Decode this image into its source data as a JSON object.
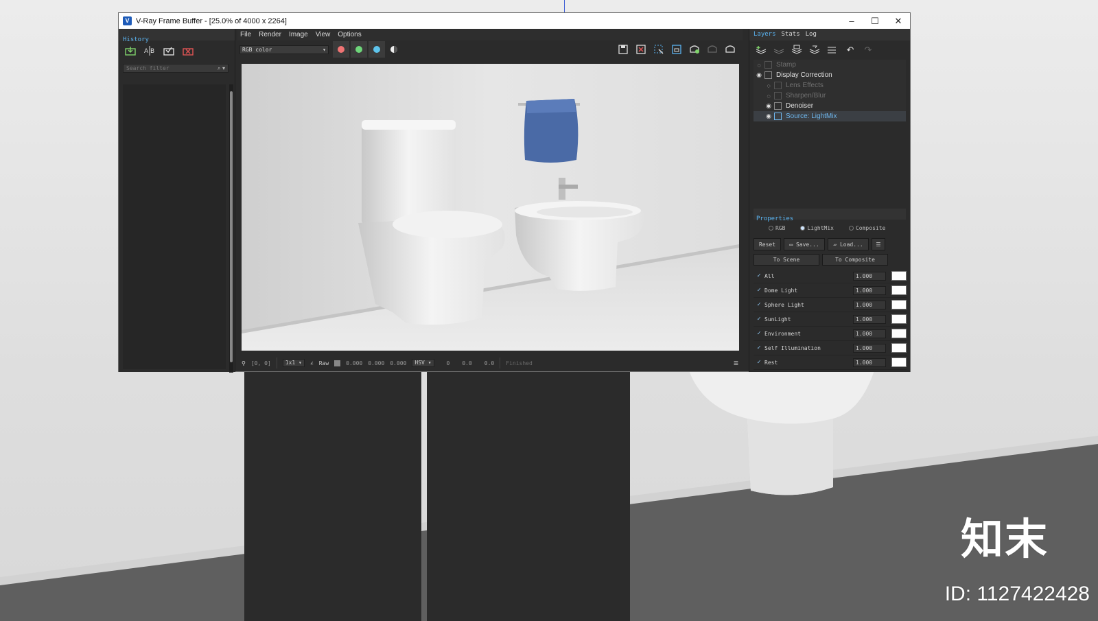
{
  "window": {
    "title": "V-Ray Frame Buffer - [25.0% of 4000 x 2264]",
    "icon": "vray-icon",
    "controls": [
      "–",
      "☐",
      "✕"
    ]
  },
  "history": {
    "tab": "History",
    "search_placeholder": "Search filter",
    "icons": [
      "save-to-history-icon",
      "ab-compare-icon",
      "load-history-icon",
      "remove-history-icon"
    ]
  },
  "menu": [
    "File",
    "Render",
    "Image",
    "View",
    "Options"
  ],
  "toolbar": {
    "channel": "RGB color",
    "colors": {
      "red": "#f07474",
      "green": "#6ed67a",
      "blue": "#5ec4ec"
    }
  },
  "status": {
    "coords": "[0, 0]",
    "zoom": "1x1",
    "raw_label": "Raw",
    "rgb_values": [
      "0.000",
      "0.000",
      "0.000"
    ],
    "color_space": "HSV",
    "hsv_values": [
      "0",
      "0.0",
      "0.0"
    ],
    "state": "Finished"
  },
  "right_panel": {
    "tabs": [
      "Layers",
      "Stats",
      "Log"
    ],
    "layers": [
      {
        "name": "Stamp",
        "visible": false,
        "sub": false
      },
      {
        "name": "Display Correction",
        "visible": true,
        "sub": false
      },
      {
        "name": "Lens Effects",
        "visible": false,
        "sub": true
      },
      {
        "name": "Sharpen/Blur",
        "visible": false,
        "sub": true
      },
      {
        "name": "Denoiser",
        "visible": true,
        "sub": true
      },
      {
        "name": "Source: LightMix",
        "visible": true,
        "sub": true
      }
    ],
    "properties_label": "Properties",
    "modes": [
      "RGB",
      "LightMix",
      "Composite"
    ],
    "selected_mode": "LightMix",
    "buttons": {
      "reset": "Reset",
      "save": "Save...",
      "load": "Load...",
      "to_scene": "To Scene",
      "to_composite": "To Composite"
    },
    "lightmix": [
      {
        "name": "All",
        "value": "1.000"
      },
      {
        "name": "Dome Light",
        "value": "1.000"
      },
      {
        "name": "Sphere Light",
        "value": "1.000"
      },
      {
        "name": "SunLight",
        "value": "1.000"
      },
      {
        "name": "Environment",
        "value": "1.000"
      },
      {
        "name": "Self Illumination",
        "value": "1.000"
      },
      {
        "name": "Rest",
        "value": "1.000"
      }
    ]
  },
  "watermark": {
    "logo": "知末",
    "id": "ID: 1127422428"
  }
}
